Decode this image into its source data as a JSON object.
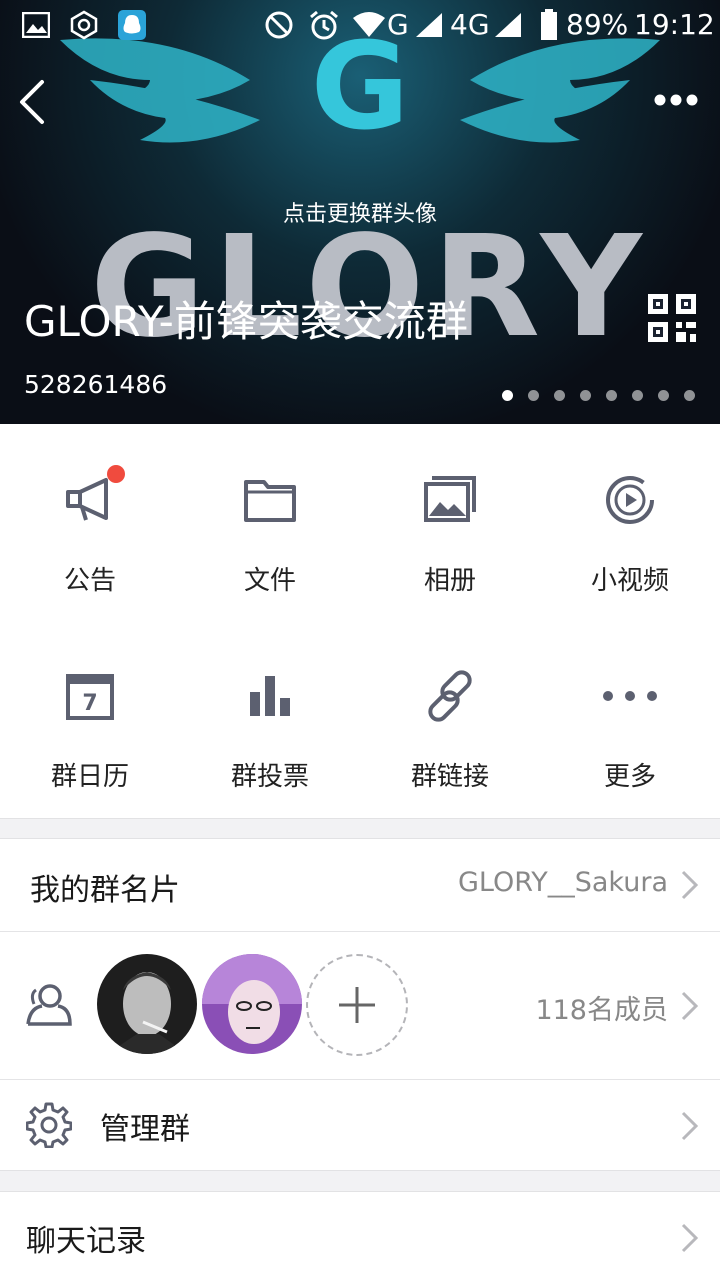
{
  "status_bar": {
    "battery": "89%",
    "time": "19:12",
    "network_1": "G",
    "network_2": "4G"
  },
  "header": {
    "avatar_hint": "点击更换群头像",
    "group_name": "GLORY-前锋突袭交流群",
    "group_id": "528261486",
    "banner_logo_text": "GLORY",
    "banner_logo_letter": "G",
    "carousel_total_pages": 8,
    "carousel_active_page": 1
  },
  "features": [
    {
      "label": "公告",
      "icon": "megaphone-icon",
      "has_badge": true
    },
    {
      "label": "文件",
      "icon": "folder-icon"
    },
    {
      "label": "相册",
      "icon": "photo-album-icon"
    },
    {
      "label": "小视频",
      "icon": "video-icon"
    },
    {
      "label": "群日历",
      "icon": "calendar-icon",
      "icon_text": "7"
    },
    {
      "label": "群投票",
      "icon": "bar-chart-icon"
    },
    {
      "label": "群链接",
      "icon": "link-icon"
    },
    {
      "label": "更多",
      "icon": "more-dots-icon"
    }
  ],
  "group_card": {
    "label": "我的群名片",
    "value": "GLORY__Sakura"
  },
  "members": {
    "count_text": "118名成员"
  },
  "manage": {
    "label": "管理群"
  },
  "chat_history": {
    "label": "聊天记录"
  },
  "colors": {
    "icon_gray": "#5c6070",
    "badge_red": "#f04b3e",
    "separator": "#f2f2f4"
  }
}
